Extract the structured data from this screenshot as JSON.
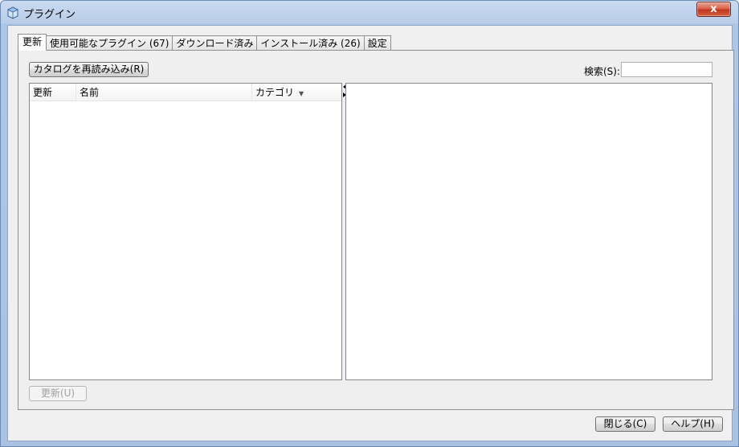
{
  "window": {
    "title": "プラグイン",
    "close_label": "x",
    "icon": "netbeans-cube-icon"
  },
  "tabs": [
    {
      "label": "更新",
      "active": true
    },
    {
      "label": "使用可能なプラグイン (67)",
      "active": false
    },
    {
      "label": "ダウンロード済み",
      "active": false
    },
    {
      "label": "インストール済み (26)",
      "active": false
    },
    {
      "label": "設定",
      "active": false
    }
  ],
  "toolbar": {
    "reload_label": "カタログを再読み込み(R)",
    "search_label": "検索(S):",
    "search_value": ""
  },
  "table": {
    "columns": [
      "更新",
      "名前",
      "カテゴリ"
    ],
    "sort_icon": "sort-down-icon",
    "rows": []
  },
  "actions": {
    "update_label": "更新(U)",
    "update_enabled": false
  },
  "footer": {
    "close_label": "閉じる(C)",
    "help_label": "ヘルプ(H)"
  },
  "colors": {
    "title_gradient_top": "#c9daf0",
    "close_red": "#c2351c",
    "panel_bg": "#efefef"
  }
}
